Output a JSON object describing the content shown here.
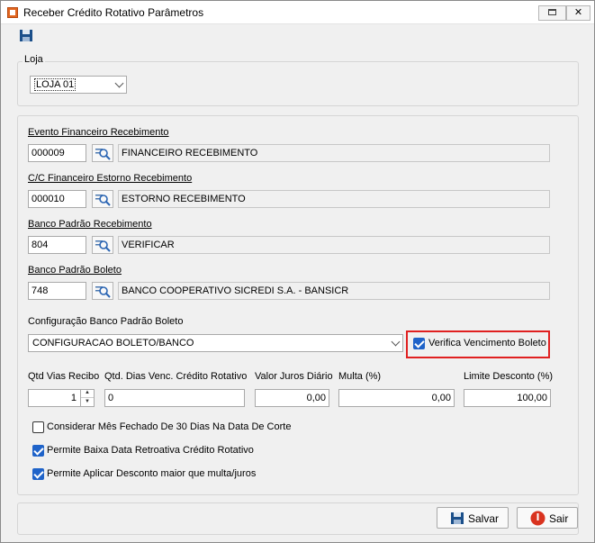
{
  "window": {
    "title": "Receber Crédito Rotativo Parâmetros"
  },
  "loja": {
    "group_label": "Loja",
    "selected": "LOJA 01"
  },
  "evento": {
    "label": "Evento Financeiro Recebimento",
    "code": "000009",
    "desc": "FINANCEIRO RECEBIMENTO"
  },
  "cc_estorno": {
    "label": "C/C Financeiro Estorno Recebimento",
    "code": "000010",
    "desc": "ESTORNO RECEBIMENTO"
  },
  "banco_receb": {
    "label": "Banco Padrão Recebimento",
    "code": "804",
    "desc": "VERIFICAR"
  },
  "banco_boleto": {
    "label": "Banco Padrão Boleto",
    "code": "748",
    "desc": "BANCO COOPERATIVO SICREDI S.A. - BANSICR"
  },
  "config_boleto": {
    "label": "Configuração Banco Padrão Boleto",
    "selected": "CONFIGURACAO BOLETO/BANCO"
  },
  "verifica_venc": {
    "label": "Verifica Vencimento Boleto",
    "checked": true
  },
  "fields": {
    "qtd_vias": {
      "label": "Qtd Vias Recibo",
      "value": "1"
    },
    "qtd_dias": {
      "label": "Qtd. Dias Venc. Crédito Rotativo",
      "value": "0"
    },
    "juros": {
      "label": "Valor Juros Diário",
      "value": "0,00"
    },
    "multa": {
      "label": "Multa (%)",
      "value": "0,00"
    },
    "limite": {
      "label": "Limite Desconto (%)",
      "value": "100,00"
    }
  },
  "options": [
    {
      "label": "Considerar Mês Fechado De 30 Dias Na Data De Corte",
      "checked": false
    },
    {
      "label": "Permite Baixa Data Retroativa Crédito Rotativo",
      "checked": true
    },
    {
      "label": "Permite Aplicar Desconto maior que multa/juros",
      "checked": true
    }
  ],
  "buttons": {
    "save": "Salvar",
    "exit": "Sair"
  },
  "icons": {
    "app": "app-icon",
    "save": "floppy-disk-icon",
    "lookup": "search-list-icon",
    "exit": "power-icon"
  }
}
